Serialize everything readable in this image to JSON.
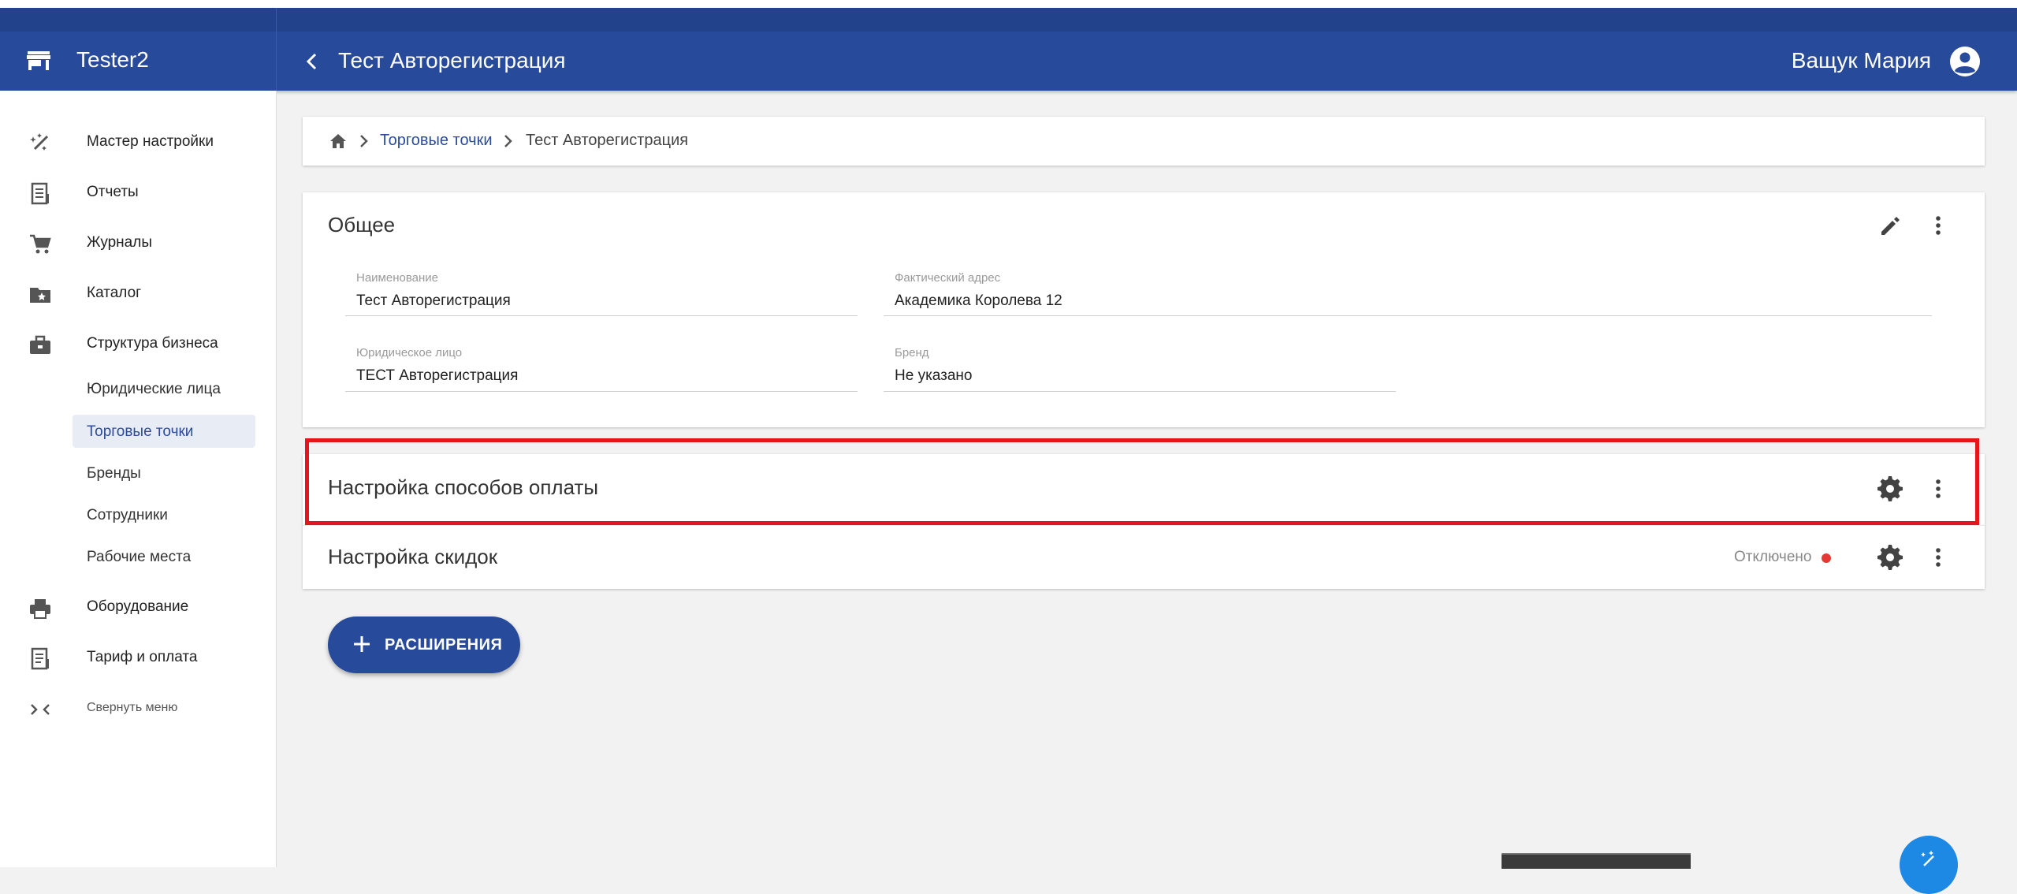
{
  "app": {
    "org_name": "Tester2",
    "page_title": "Тест Авторегистрация",
    "user_name": "Ващук Мария"
  },
  "sidebar": {
    "items": [
      {
        "label": "Мастер настройки",
        "icon": "magic-wand-icon"
      },
      {
        "label": "Отчеты",
        "icon": "receipt-icon"
      },
      {
        "label": "Журналы",
        "icon": "cart-icon"
      },
      {
        "label": "Каталог",
        "icon": "folder-star-icon"
      },
      {
        "label": "Структура бизнеса",
        "icon": "briefcase-icon"
      }
    ],
    "sub_items": [
      {
        "label": "Юридические лица",
        "active": false
      },
      {
        "label": "Торговые точки",
        "active": true
      },
      {
        "label": "Бренды",
        "active": false
      },
      {
        "label": "Сотрудники",
        "active": false
      },
      {
        "label": "Рабочие места",
        "active": false
      }
    ],
    "bottom_items": [
      {
        "label": "Оборудование",
        "icon": "printer-icon"
      },
      {
        "label": "Тариф и оплата",
        "icon": "invoice-icon"
      }
    ],
    "collapse_label": "Свернуть меню"
  },
  "breadcrumb": {
    "link": "Торговые точки",
    "current": "Тест Авторегистрация"
  },
  "general": {
    "title": "Общее",
    "fields": {
      "name": {
        "label": "Наименование",
        "value": "Тест Авторегистрация"
      },
      "address": {
        "label": "Фактический адрес",
        "value": "Академика Королева 12"
      },
      "legal": {
        "label": "Юридическое лицо",
        "value": "ТЕСТ Авторегистрация"
      },
      "brand": {
        "label": "Бренд",
        "value": "Не указано"
      }
    }
  },
  "payment": {
    "title": "Настройка способов оплаты"
  },
  "discount": {
    "title": "Настройка скидок",
    "status": "Отключено"
  },
  "extensions_button": "РАСШИРЕНИЯ",
  "colors": {
    "primary": "#284a9a",
    "highlight": "#e8141c",
    "status_off": "#e53935",
    "fab": "#1e88e5"
  }
}
